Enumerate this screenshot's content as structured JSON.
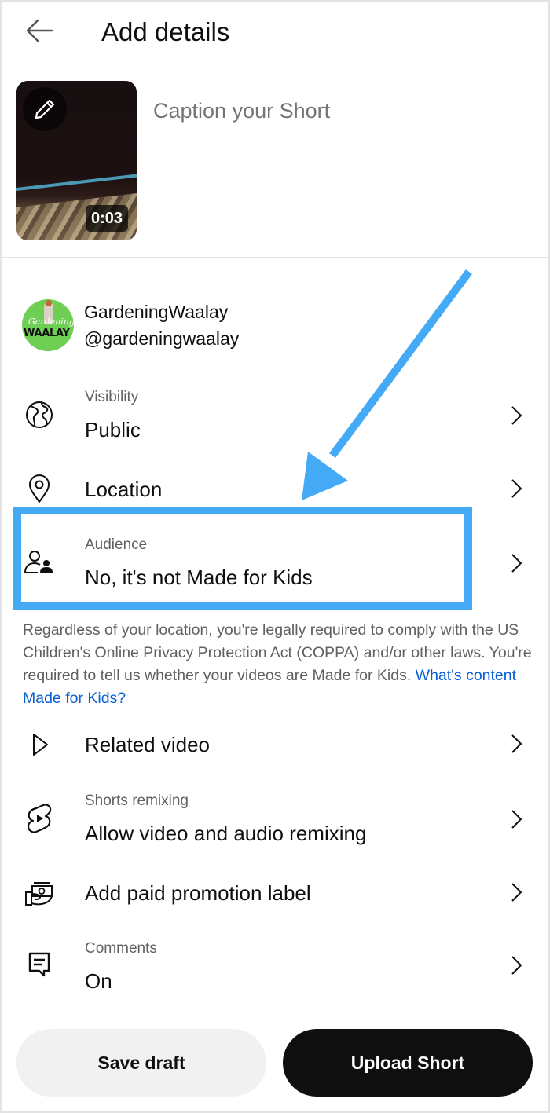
{
  "header": {
    "title": "Add details",
    "back_icon": "arrow-left-icon"
  },
  "video": {
    "duration": "0:03",
    "edit_icon": "pencil-icon"
  },
  "caption": {
    "placeholder": "Caption your Short",
    "value": ""
  },
  "channel": {
    "name": "GardeningWaalay",
    "handle": "@gardeningwaalay",
    "avatar_script": "Gardening",
    "avatar_brand": "WAALAY"
  },
  "settings": [
    {
      "id": "visibility",
      "icon": "globe-icon",
      "label": "Visibility",
      "value": "Public"
    },
    {
      "id": "location",
      "icon": "location-pin-icon",
      "label": "",
      "value": "Location"
    },
    {
      "id": "audience",
      "icon": "audience-icon",
      "label": "Audience",
      "value": "No, it's not Made for Kids"
    },
    {
      "id": "related-video",
      "icon": "play-outline-icon",
      "label": "",
      "value": "Related video"
    },
    {
      "id": "shorts-remixing",
      "icon": "shorts-icon",
      "label": "Shorts remixing",
      "value": "Allow video and audio remixing"
    },
    {
      "id": "paid-promotion",
      "icon": "paid-promotion-icon",
      "label": "",
      "value": "Add paid promotion label"
    },
    {
      "id": "comments",
      "icon": "comment-icon",
      "label": "Comments",
      "value": "On"
    }
  ],
  "notice": {
    "text": "Regardless of your location, you're legally required to comply with the US Children's Online Privacy Protection Act (COPPA) and/or other laws. You're required to tell us whether your videos are Made for Kids. ",
    "link": "What's content Made for Kids?"
  },
  "buttons": {
    "save_draft": "Save draft",
    "upload": "Upload Short"
  },
  "annotation": {
    "color": "#45aaf5",
    "target": "audience"
  },
  "colors": {
    "link": "#065fd4",
    "primary_button": "#0f0f0f",
    "secondary_button": "#f1f1f1"
  }
}
